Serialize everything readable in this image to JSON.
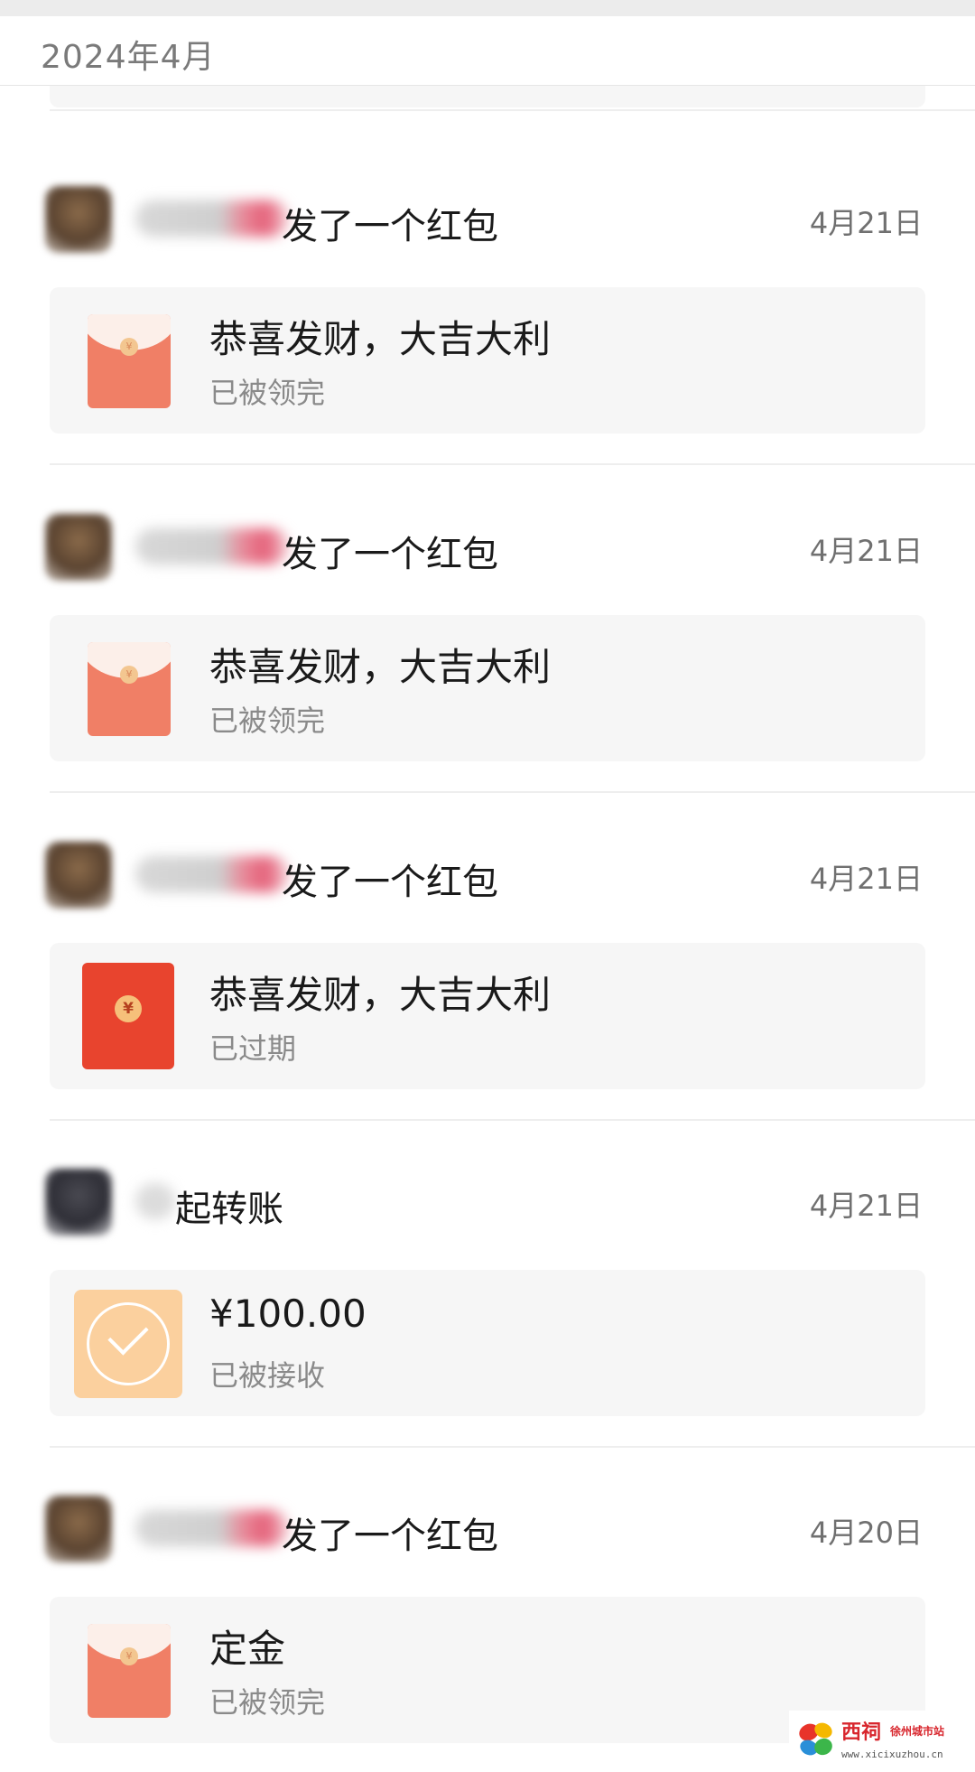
{
  "month_header": "2024年4月",
  "records": [
    {
      "kind": "red_packet",
      "title": "发了一个红包",
      "date": "4月21日",
      "card_main": "恭喜发财，大吉大利",
      "card_status": "已被领完",
      "expired": false
    },
    {
      "kind": "red_packet",
      "title": "发了一个红包",
      "date": "4月21日",
      "card_main": "恭喜发财，大吉大利",
      "card_status": "已被领完",
      "expired": false
    },
    {
      "kind": "red_packet",
      "title": "发了一个红包",
      "date": "4月21日",
      "card_main": "恭喜发财，大吉大利",
      "card_status": "已过期",
      "expired": true
    },
    {
      "kind": "transfer",
      "title": "起转账",
      "date": "4月21日",
      "card_main": "¥100.00",
      "card_status": "已被接收"
    },
    {
      "kind": "red_packet",
      "title": "发了一个红包",
      "date": "4月20日",
      "card_main": "定金",
      "card_status": "已被领完",
      "expired": false
    }
  ],
  "icons": {
    "red_packet": "red-envelope-icon",
    "red_packet_expired": "red-envelope-expired-icon",
    "transfer": "transfer-accepted-check-icon",
    "coin_glyph": "¥"
  },
  "colors": {
    "red_packet": "#f07f66",
    "red_packet_expired": "#e8442e",
    "transfer": "#fbd09e",
    "secondary_text": "#8a8a8a"
  },
  "watermark": {
    "brand": "西祠",
    "site": "徐州城市站",
    "url": "www.xicixuzhou.cn"
  }
}
